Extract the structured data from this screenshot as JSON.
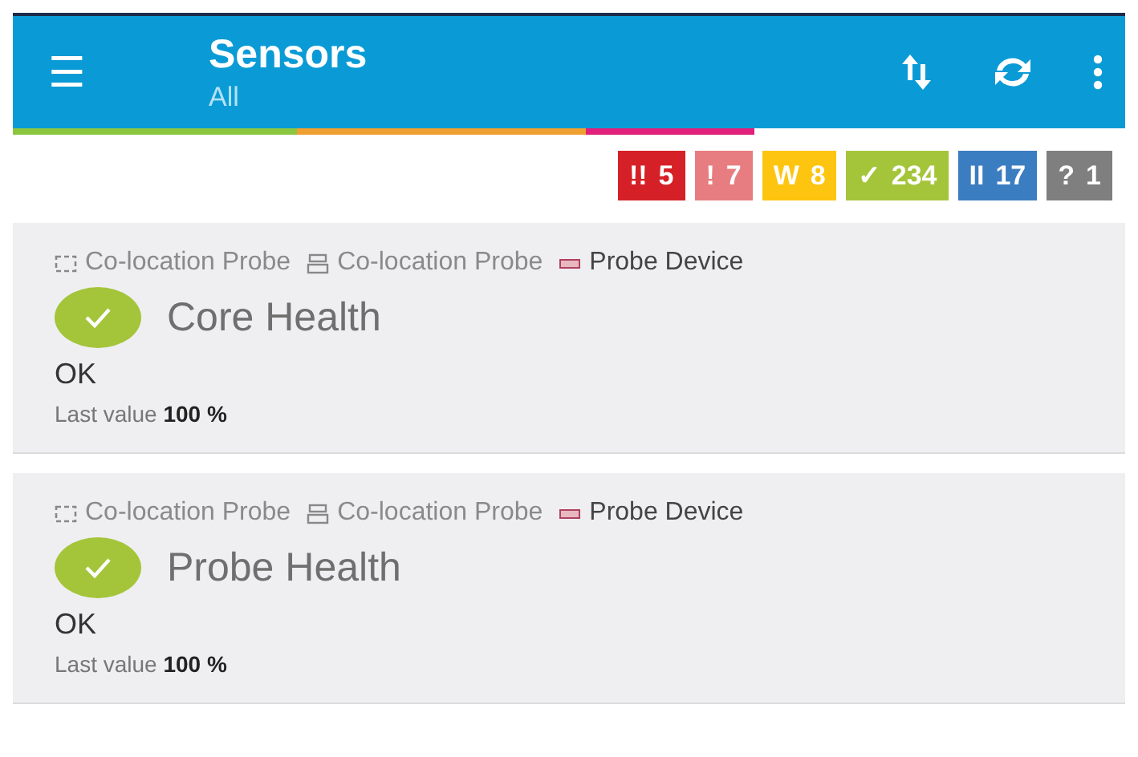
{
  "app_bar": {
    "menu_icon": "☰",
    "title": "Sensors",
    "subtitle": "All"
  },
  "badges": [
    {
      "symbol": "!!",
      "count": "5",
      "color": "#d52027"
    },
    {
      "symbol": "!",
      "count": "7",
      "color": "#e77d80"
    },
    {
      "symbol": "W",
      "count": "8",
      "color": "#fdc50f"
    },
    {
      "symbol": "✓",
      "count": "234",
      "color": "#a4c53a"
    },
    {
      "symbol": "II",
      "count": "17",
      "color": "#3b7dc1"
    },
    {
      "symbol": "?",
      "count": "1",
      "color": "#7f7f7f"
    }
  ],
  "sensors": [
    {
      "path": [
        {
          "kind": "group",
          "label": "Co-location Probe"
        },
        {
          "kind": "device",
          "label": "Co-location Probe"
        },
        {
          "kind": "probe",
          "label": "Probe Device"
        }
      ],
      "name": "Core Health",
      "color": "#a4c53a",
      "status": "OK",
      "last_value": "Last value **100 %**"
    },
    {
      "path": [
        {
          "kind": "group",
          "label": "Co-location Probe"
        },
        {
          "kind": "device",
          "label": "Co-location Probe"
        },
        {
          "kind": "probe",
          "label": "Probe Device"
        }
      ],
      "name": "Probe Health",
      "color": "#a4c53a",
      "status": "OK",
      "last_value": "Last value **100 %**"
    }
  ]
}
